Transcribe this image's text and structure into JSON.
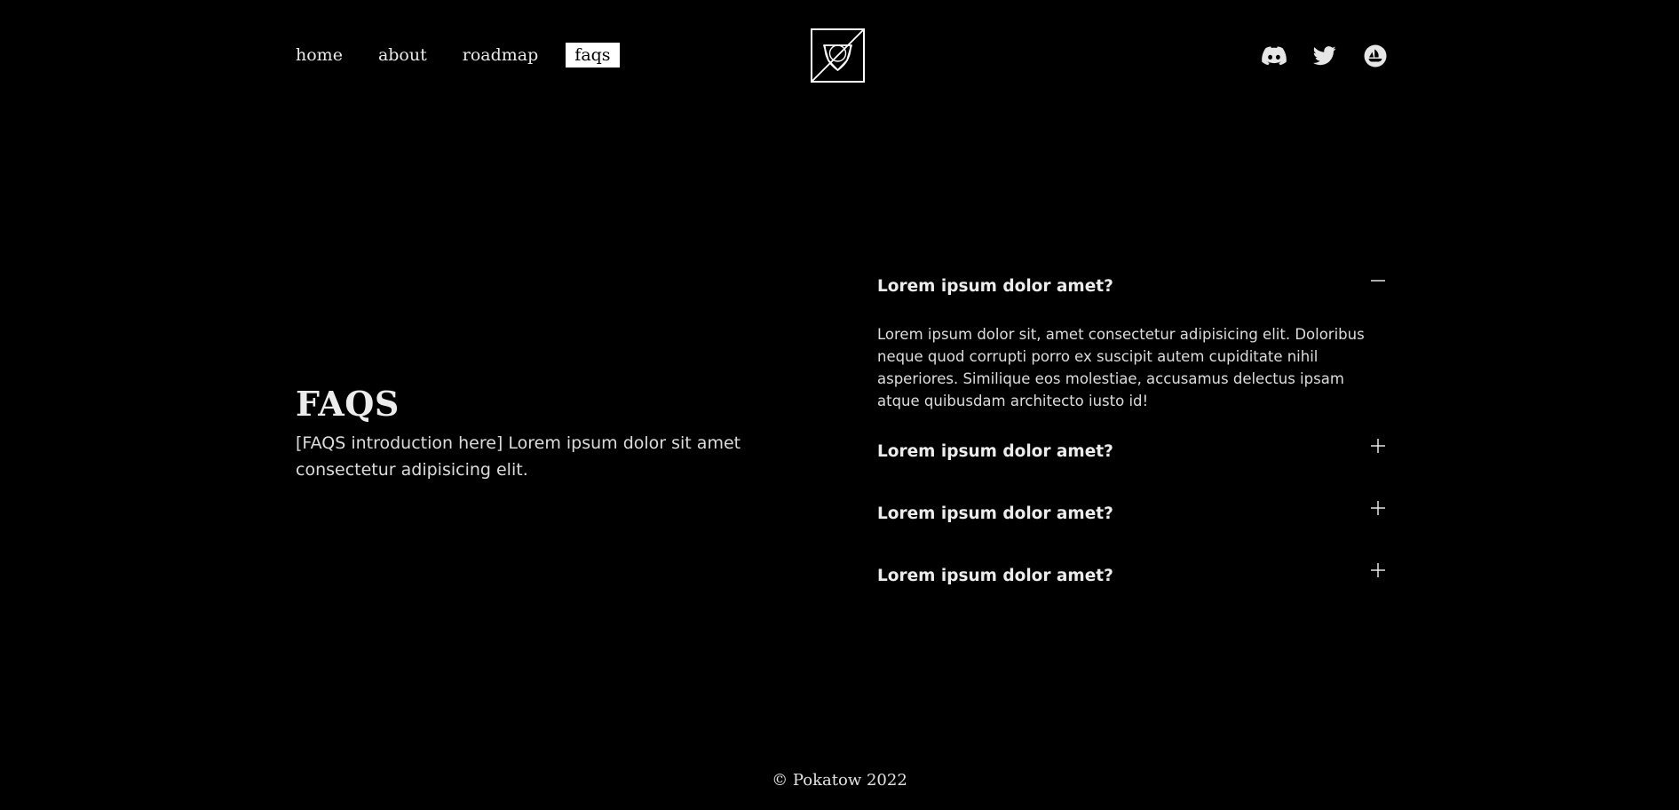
{
  "nav": {
    "items": [
      {
        "label": "home",
        "active": false
      },
      {
        "label": "about",
        "active": false
      },
      {
        "label": "roadmap",
        "active": false
      },
      {
        "label": "faqs",
        "active": true
      }
    ]
  },
  "logo": {
    "icon": "brand-shield-logo-icon"
  },
  "social": {
    "icons": [
      "discord-icon",
      "twitter-icon",
      "opensea-icon"
    ]
  },
  "intro": {
    "title": "FAQS",
    "text": "[FAQS introduction here] Lorem ipsum dolor sit amet consectetur adipisicing elit."
  },
  "faqs": [
    {
      "question": "Lorem ipsum dolor amet?",
      "answer": "Lorem ipsum dolor sit, amet consectetur adipisicing elit. Doloribus neque quod corrupti porro ex suscipit autem cupiditate nihil asperiores. Similique eos molestiae, accusamus delectus ipsam atque quibusdam architecto iusto id!",
      "expanded": true,
      "toggle_icon": "minus-icon"
    },
    {
      "question": "Lorem ipsum dolor amet?",
      "expanded": false,
      "toggle_icon": "plus-icon"
    },
    {
      "question": "Lorem ipsum dolor amet?",
      "expanded": false,
      "toggle_icon": "plus-icon"
    },
    {
      "question": "Lorem ipsum dolor amet?",
      "expanded": false,
      "toggle_icon": "plus-icon"
    }
  ],
  "footer": {
    "text": "© Pokatow 2022"
  },
  "colors": {
    "background": "#000000",
    "text": "#e6e6e6",
    "active_nav_bg": "#ffffff"
  }
}
